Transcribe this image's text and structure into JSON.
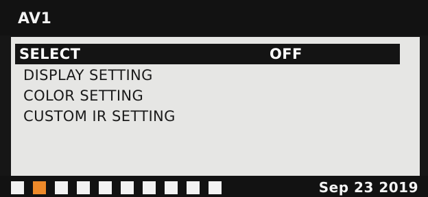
{
  "header": {
    "title": "AV1"
  },
  "menu": {
    "items": [
      {
        "label": "SELECT",
        "value": "OFF",
        "selected": true
      },
      {
        "label": "DISPLAY SETTING"
      },
      {
        "label": "COLOR SETTING"
      },
      {
        "label": "CUSTOM IR SETTING"
      }
    ]
  },
  "status": {
    "indicators": [
      "off",
      "on",
      "off",
      "off",
      "off",
      "off",
      "off",
      "off",
      "off",
      "off"
    ],
    "indicator_colors": {
      "on": "#ee8a2a",
      "off": "#f2f2f2"
    },
    "date": "Sep 23 2019"
  }
}
